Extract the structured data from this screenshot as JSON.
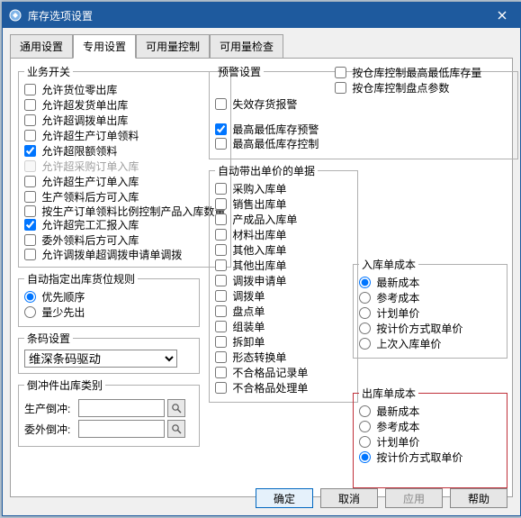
{
  "title": "库存选项设置",
  "tabs": [
    "通用设置",
    "专用设置",
    "可用量控制",
    "可用量检查"
  ],
  "active_tab": 1,
  "business": {
    "legend": "业务开关",
    "items": [
      {
        "label": "允许货位零出库",
        "checked": false
      },
      {
        "label": "允许超发货单出库",
        "checked": false
      },
      {
        "label": "允许超调拨单出库",
        "checked": false
      },
      {
        "label": "允许超生产订单领料",
        "checked": false
      },
      {
        "label": "允许超限额领料",
        "checked": true
      },
      {
        "label": "允许超采购订单入库",
        "checked": false,
        "disabled": true
      },
      {
        "label": "允许超生产订单入库",
        "checked": false
      },
      {
        "label": "生产领料后方可入库",
        "checked": false
      },
      {
        "label": "按生产订单领料比例控制产品入库数量",
        "checked": false,
        "two": true
      },
      {
        "label": "允许超完工汇报入库",
        "checked": true
      },
      {
        "label": "委外领料后方可入库",
        "checked": false
      },
      {
        "label": "允许调拨单超调拨申请单调拨",
        "checked": false,
        "two": true
      }
    ]
  },
  "auto_out": {
    "legend": "自动指定出库货位规则",
    "items": [
      {
        "label": "优先顺序",
        "checked": true
      },
      {
        "label": "量少先出",
        "checked": false
      }
    ]
  },
  "barcode": {
    "legend": "条码设置",
    "selected": "维深条码驱动"
  },
  "offset": {
    "legend": "倒冲件出库类别",
    "row1": "生产倒冲:",
    "row2": "委外倒冲:",
    "v1": "",
    "v2": ""
  },
  "alert": {
    "legend": "预警设置",
    "a1": {
      "label": "失效存货报警",
      "checked": false
    },
    "a2": {
      "label": "按仓库控制最高最低库存量",
      "checked": false
    },
    "a3": {
      "label": "按仓库控制盘点参数",
      "checked": false
    },
    "a4": {
      "label": "最高最低库存预警",
      "checked": true
    },
    "a5": {
      "label": "最高最低库存控制",
      "checked": false
    }
  },
  "auto_price": {
    "legend": "自动带出单价的单据",
    "items": [
      {
        "label": "采购入库单",
        "checked": false
      },
      {
        "label": "销售出库单",
        "checked": false
      },
      {
        "label": "产成品入库单",
        "checked": false
      },
      {
        "label": "材料出库单",
        "checked": false
      },
      {
        "label": "其他入库单",
        "checked": false
      },
      {
        "label": "其他出库单",
        "checked": false
      },
      {
        "label": "调拨申请单",
        "checked": false
      },
      {
        "label": "调拨单",
        "checked": false
      },
      {
        "label": "盘点单",
        "checked": false
      },
      {
        "label": "组装单",
        "checked": false
      },
      {
        "label": "拆卸单",
        "checked": false
      },
      {
        "label": "形态转换单",
        "checked": false
      },
      {
        "label": "不合格品记录单",
        "checked": false
      },
      {
        "label": "不合格品处理单",
        "checked": false
      }
    ]
  },
  "in_cost": {
    "legend": "入库单成本",
    "items": [
      {
        "label": "最新成本",
        "checked": true
      },
      {
        "label": "参考成本",
        "checked": false
      },
      {
        "label": "计划单价",
        "checked": false
      },
      {
        "label": "按计价方式取单价",
        "checked": false
      },
      {
        "label": "上次入库单价",
        "checked": false
      }
    ]
  },
  "out_cost": {
    "legend": "出库单成本",
    "items": [
      {
        "label": "最新成本",
        "checked": false
      },
      {
        "label": "参考成本",
        "checked": false
      },
      {
        "label": "计划单价",
        "checked": false
      },
      {
        "label": "按计价方式取单价",
        "checked": true
      }
    ]
  },
  "buttons": {
    "ok": "确定",
    "cancel": "取消",
    "apply": "应用",
    "help": "帮助"
  }
}
